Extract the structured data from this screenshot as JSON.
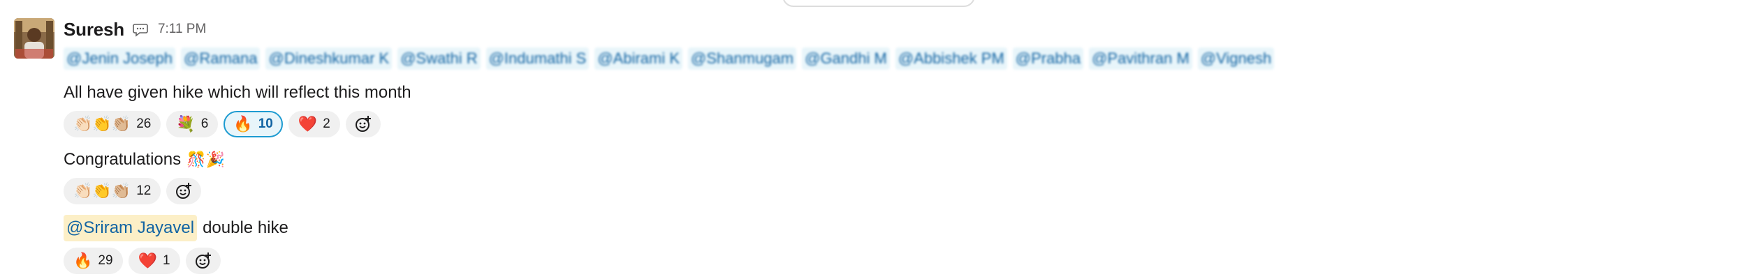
{
  "sender": {
    "name": "Suresh",
    "time": "7:11 PM",
    "avatar_icon": "user-photo",
    "status_icon": "speech-bubble-icon"
  },
  "mentions": [
    "@Jenin Joseph",
    "@Ramana",
    "@Dineshkumar K",
    "@Swathi R",
    "@Indumathi S",
    "@Abirami K",
    "@Shanmugam",
    "@Gandhi M",
    "@Abbishek PM",
    "@Prabha",
    "@Pavithran M",
    "@Vignesh"
  ],
  "messages": [
    {
      "text": "All have given hike which will reflect this month",
      "reactions": [
        {
          "emoji": "👏🏻👏👏🏼",
          "icon": "clap-icon",
          "count": "26"
        },
        {
          "emoji": "💐",
          "icon": "bouquet-icon",
          "count": "6"
        },
        {
          "emoji": "🔥",
          "icon": "fire-icon",
          "count": "10",
          "active": true
        },
        {
          "emoji": "❤️",
          "icon": "heart-icon",
          "count": "2"
        }
      ]
    },
    {
      "text": "Congratulations",
      "emojis": "🎊🎉",
      "reactions": [
        {
          "emoji": "👏🏻👏👏🏼",
          "icon": "clap-icon",
          "count": "12"
        }
      ]
    },
    {
      "mention": "@Sriram Jayavel",
      "text": "double hike",
      "reactions": [
        {
          "emoji": "🔥",
          "icon": "fire-icon",
          "count": "29"
        },
        {
          "emoji": "❤️",
          "icon": "heart-icon",
          "count": "1"
        }
      ]
    }
  ],
  "colors": {
    "mention_text": "#1264a3",
    "mention_bg": "#e8f5fa",
    "user_mention_bg": "#fcefc7",
    "active_reaction_border": "#1d9bd1",
    "reaction_bg": "#f0f0f0"
  }
}
